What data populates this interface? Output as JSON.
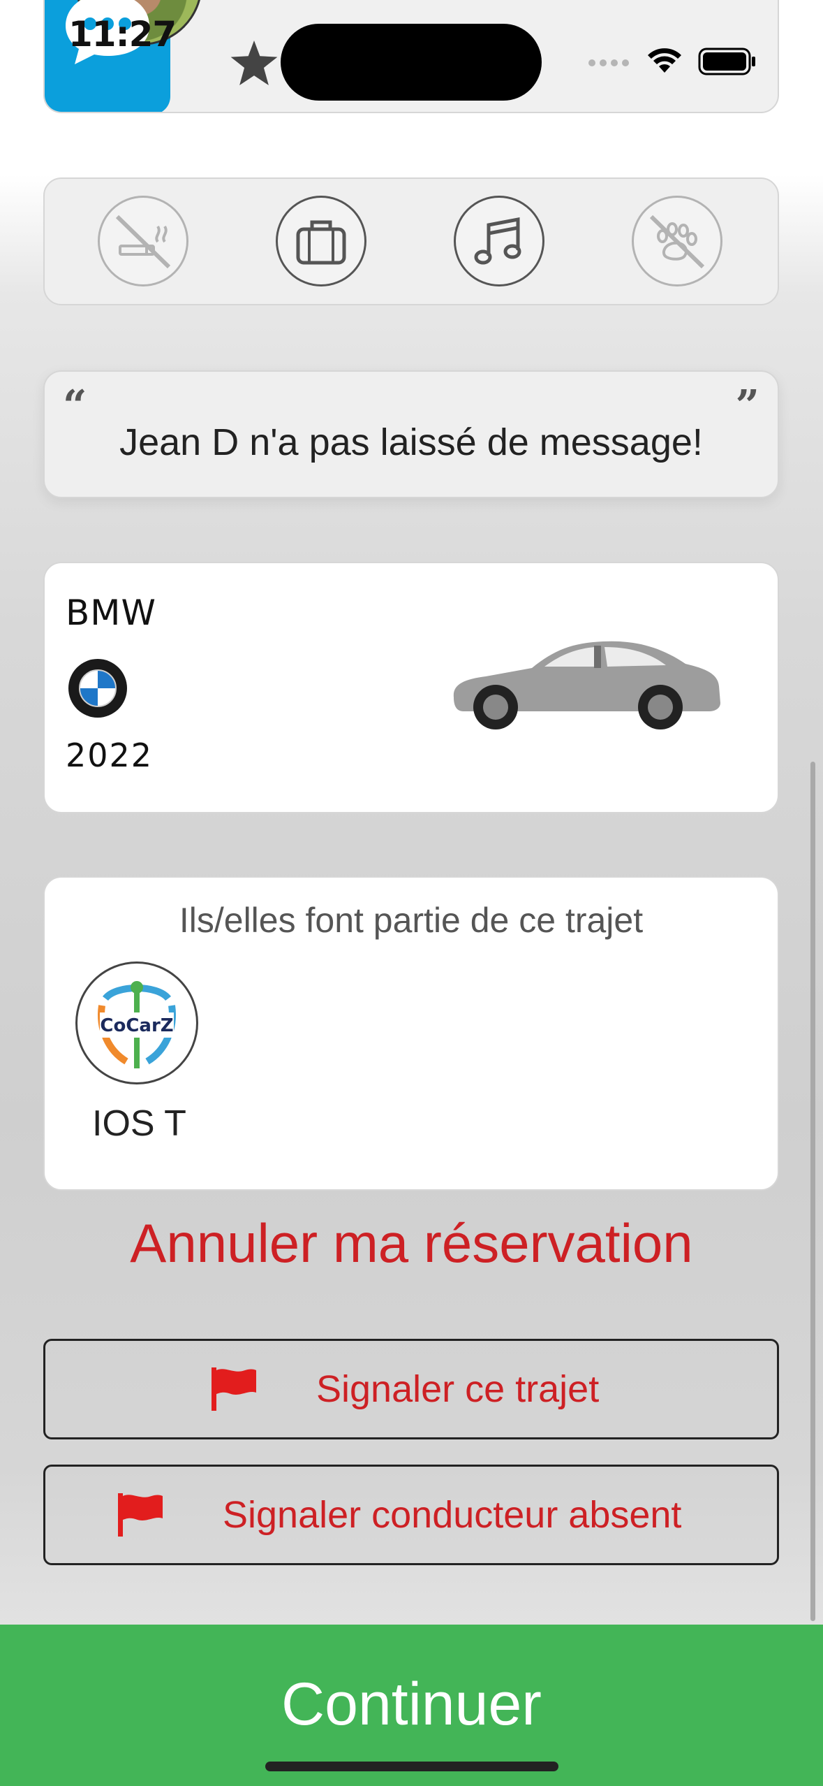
{
  "status_bar": {
    "time": "11:27"
  },
  "driver": {
    "avatar": "driver-avatar",
    "rating_icon": "star-icon"
  },
  "preferences": [
    {
      "icon": "no-smoking-icon",
      "allowed": false
    },
    {
      "icon": "luggage-icon",
      "allowed": true
    },
    {
      "icon": "music-icon",
      "allowed": true
    },
    {
      "icon": "no-pets-icon",
      "allowed": false
    }
  ],
  "message": {
    "text": "Jean D n'a pas laissé de message!"
  },
  "car": {
    "brand": "BMW",
    "year": "2022",
    "logo": "bmw-logo"
  },
  "passengers": {
    "title": "Ils/elles font partie de ce trajet",
    "items": [
      {
        "name": "IOS T",
        "avatar_text": "CoCarZ"
      }
    ]
  },
  "actions": {
    "cancel": "Annuler ma réservation",
    "report_trip": "Signaler ce trajet",
    "report_absent": "Signaler conducteur absent",
    "continue": "Continuer"
  },
  "colors": {
    "accent_red": "#cd2024",
    "continue_green": "#43b557",
    "chat_blue": "#0b9fdc"
  }
}
